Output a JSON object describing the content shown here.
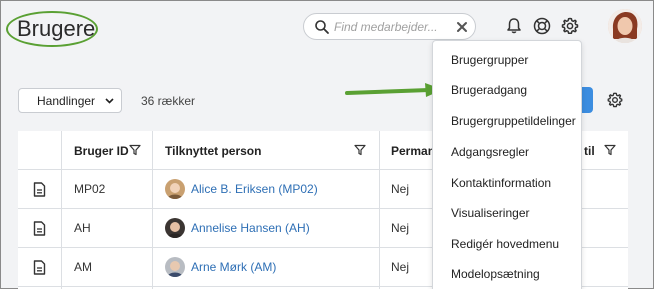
{
  "header": {
    "title": "Brugere",
    "search": {
      "placeholder": "Find medarbejder..."
    },
    "icons": [
      "bell-icon",
      "help-lifebuoy-icon",
      "gear-icon"
    ]
  },
  "toolbar": {
    "actions_label": "Handlinger",
    "row_count": "36 rækker"
  },
  "table": {
    "columns": [
      "Bruger ID",
      "Tilknyttet person",
      "Permane",
      "til"
    ],
    "rows": [
      {
        "id": "MP02",
        "person": "Alice B. Eriksen (MP02)",
        "perm": "Nej"
      },
      {
        "id": "AH",
        "person": "Annelise Hansen (AH)",
        "perm": "Nej"
      },
      {
        "id": "AM",
        "person": "Arne Mørk (AM)",
        "perm": "Nej"
      }
    ]
  },
  "dropdown": {
    "items": [
      "Brugergrupper",
      "Brugeradgang",
      "Brugergruppetildelinger",
      "Adgangsregler",
      "Kontaktinformation",
      "Visualiseringer",
      "Redigér hovedmenu",
      "Modelopsætning"
    ]
  },
  "colors": {
    "annotation_green": "#5aa033",
    "link_blue": "#2e6fb5",
    "primary_blue": "#3c8de0"
  }
}
